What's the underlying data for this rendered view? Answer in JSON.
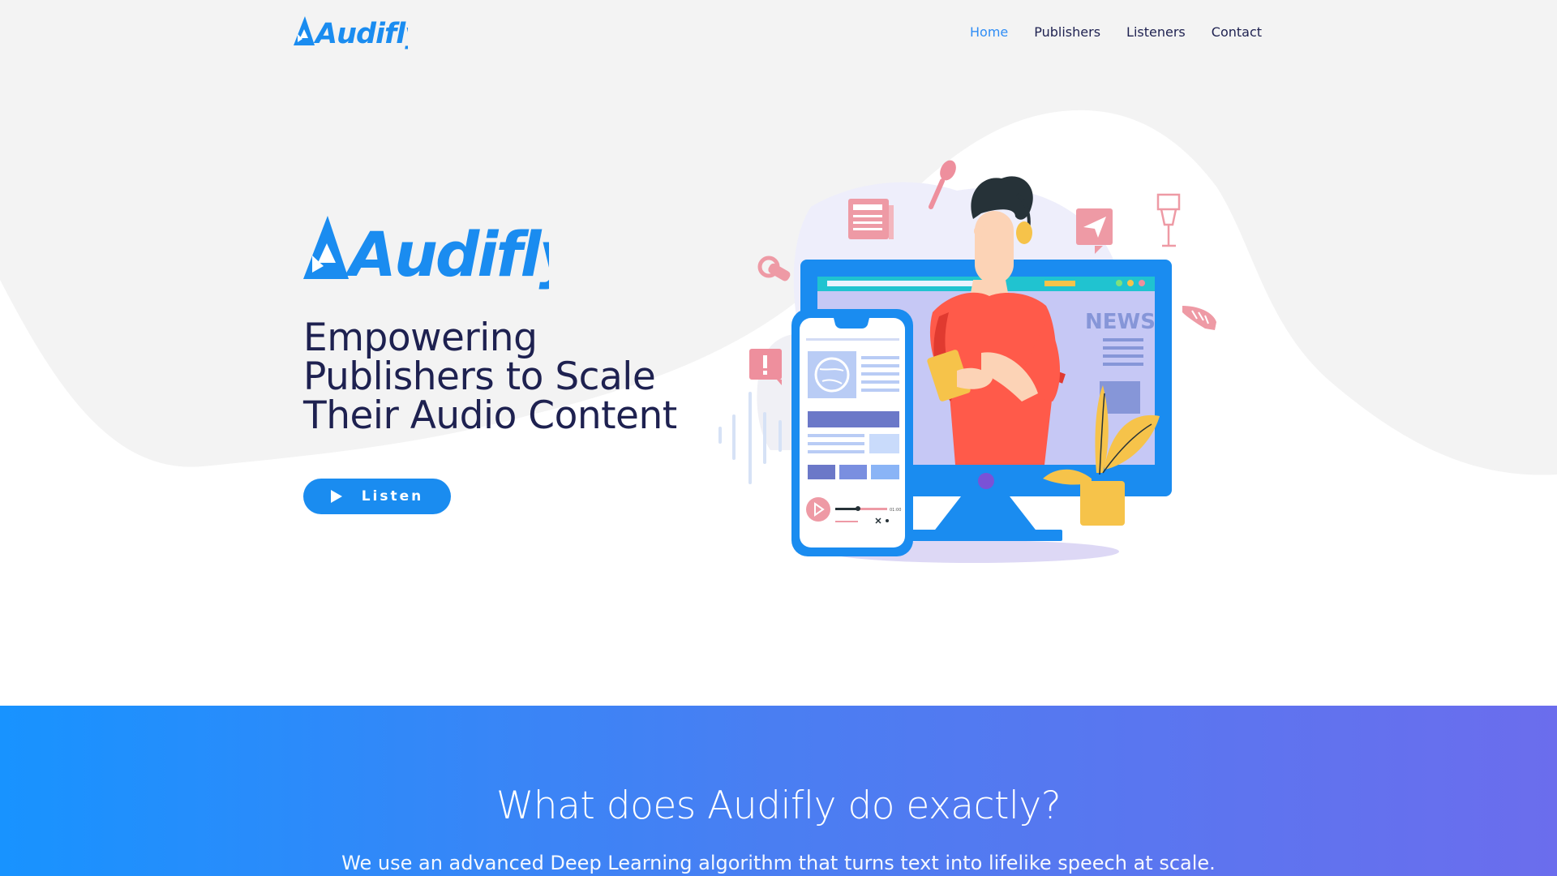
{
  "brand": {
    "name": "Audifly",
    "accent_color": "#1a8cf0",
    "text_color": "#1e2150"
  },
  "nav": {
    "items": [
      {
        "label": "Home",
        "active": true
      },
      {
        "label": "Publishers",
        "active": false
      },
      {
        "label": "Listeners",
        "active": false
      },
      {
        "label": "Contact",
        "active": false
      }
    ]
  },
  "hero": {
    "title_lines": [
      "Empowering",
      "Publishers to Scale",
      "Their Audio Content"
    ],
    "listen_label": "Listen",
    "illustration": {
      "screen_heading": "NEWS",
      "player_time": "01:00"
    }
  },
  "features": {
    "title": "What does Audifly do exactly?",
    "subtitle": "We use an advanced Deep Learning algorithm that turns text into lifelike speech at scale.",
    "gradient": [
      "#1893ff",
      "#6b6ded"
    ]
  }
}
